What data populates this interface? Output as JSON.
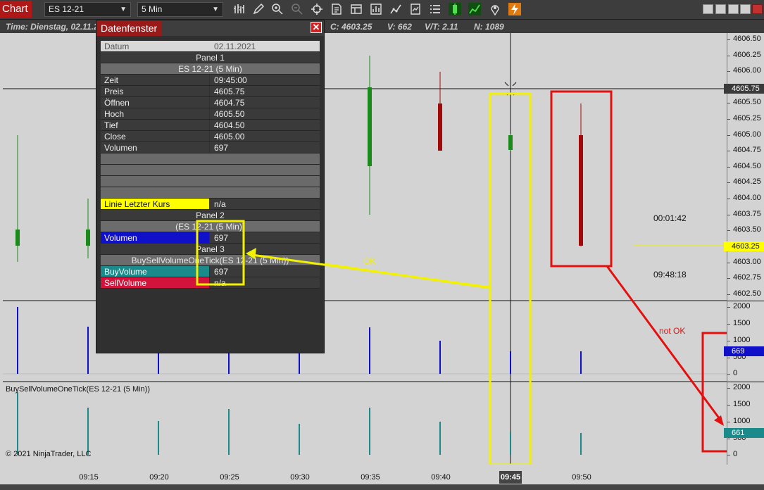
{
  "toolbar": {
    "chart_tab": "Chart",
    "instrument": "ES 12-21",
    "interval": "5 Min",
    "tool_icons": [
      "bar-type-icon",
      "pencil-icon",
      "zoom-in-icon",
      "zoom-out-icon",
      "crosshair-icon",
      "properties-icon",
      "templates-icon",
      "strategies-icon",
      "indicators-icon",
      "data-box-icon",
      "order-list-icon",
      "chart-trader-icon",
      "analyzer-icon",
      "marker-icon",
      "lightning-icon"
    ],
    "window_buttons": [
      "tile-button",
      "maximize-button",
      "minimize-button",
      "restore-button",
      "close-button"
    ]
  },
  "status": {
    "time": "Time: Dienstag, 02.11.2",
    "close": "C: 4603.25",
    "volume": "V: 662",
    "vt": "V/T: 2.11",
    "n": "N: 1089"
  },
  "data_window": {
    "title": "Datenfenster",
    "date_label": "Datum",
    "date_value": "02.11.2021",
    "panel1": "Panel 1",
    "panel1_series": "ES 12-21 (5 Min)",
    "rows": [
      {
        "k": "Zeit",
        "v": "09:45:00"
      },
      {
        "k": "Preis",
        "v": "4605.75"
      },
      {
        "k": "Öffnen",
        "v": "4604.75"
      },
      {
        "k": "Hoch",
        "v": "4605.50"
      },
      {
        "k": "Tief",
        "v": "4604.50"
      },
      {
        "k": "Close",
        "v": "4605.00"
      },
      {
        "k": "Volumen",
        "v": "697"
      }
    ],
    "last_price_label": "Linie Letzter Kurs",
    "last_price_value": "n/a",
    "panel2": "Panel 2",
    "panel2_series": "(ES 12-21 (5 Min))",
    "panel2_volume_label": "Volumen",
    "panel2_volume_value": "697",
    "panel3": "Panel 3",
    "panel3_series": "BuySellVolumeOneTick(ES 12-21 (5 Min))",
    "buy_label": "BuyVolume",
    "buy_value": "697",
    "sell_label": "SellVolume",
    "sell_value": "n/a"
  },
  "price_axis": {
    "ticks": [
      "4606.50",
      "4606.25",
      "4606.00",
      "4605.75",
      "4605.50",
      "4605.25",
      "4605.00",
      "4604.75",
      "4604.50",
      "4604.25",
      "4604.00",
      "4603.75",
      "4603.50",
      "4603.25",
      "4603.00",
      "4602.75",
      "4602.50"
    ],
    "crosshair_label": "4605.75",
    "last_price_label": "4603.25"
  },
  "volume_axis": {
    "ticks": [
      "2000",
      "1500",
      "1000",
      "500",
      "0"
    ],
    "current_label": "669"
  },
  "bsv_axis": {
    "ticks": [
      "2000",
      "1500",
      "1000",
      "500",
      "0"
    ],
    "current_label": "661"
  },
  "time_axis": {
    "ticks": [
      "09:15",
      "09:20",
      "09:25",
      "09:30",
      "09:35",
      "09:40",
      "09:50"
    ],
    "highlight": "09:45"
  },
  "chart_text": {
    "timer": "00:01:42",
    "clock": "09:48:18",
    "indicator_label": "BuySellVolumeOneTick(ES 12-21 (5 Min))",
    "copyright": "© 2021 NinjaTrader, LLC",
    "ok_note": "OK",
    "notok_note": "not OK"
  },
  "colors": {
    "up": "#1a8a1a",
    "down": "#a00a0a",
    "volume": "#1010c8",
    "buy": "#1a8a8a",
    "annotation_yellow": "#f2f200",
    "annotation_red": "#e31010",
    "last_price": "#ffff00"
  }
}
